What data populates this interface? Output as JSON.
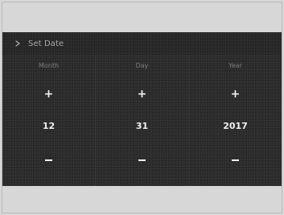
{
  "header": {
    "title": "Set Date",
    "back_icon": "chevron-right-icon"
  },
  "columns": [
    {
      "label": "Month",
      "value": "12",
      "increment_icon": "plus-icon",
      "decrement_icon": "minus-icon"
    },
    {
      "label": "Day",
      "value": "31",
      "increment_icon": "plus-icon",
      "decrement_icon": "minus-icon"
    },
    {
      "label": "Year",
      "value": "2017",
      "increment_icon": "plus-icon",
      "decrement_icon": "minus-icon"
    }
  ],
  "colors": {
    "screen_bg": "#2b2b2b",
    "outer_bg": "#d7d7d7",
    "text": "#f0f0f0",
    "muted_text": "#7c7c7c"
  }
}
